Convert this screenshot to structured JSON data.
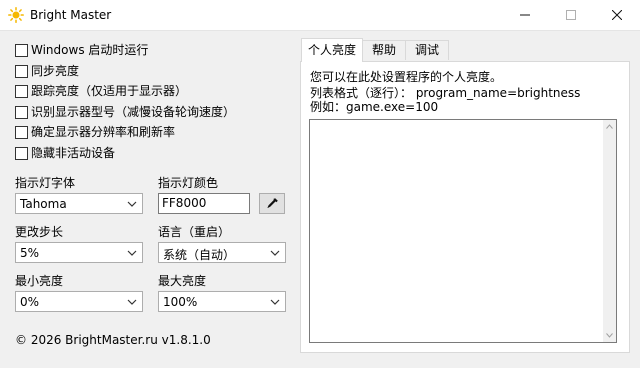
{
  "window": {
    "title": "Bright Master",
    "icon": "sun-icon",
    "minimize": "minimize-icon",
    "maximize": "maximize-icon",
    "close": "close-icon"
  },
  "checkboxes": [
    {
      "label": "Windows 启动时运行",
      "checked": false
    },
    {
      "label": "同步亮度",
      "checked": false
    },
    {
      "label": "跟踪亮度（仅适用于显示器）",
      "checked": false
    },
    {
      "label": "识别显示器型号（减慢设备轮询速度）",
      "checked": false
    },
    {
      "label": "确定显示器分辨率和刷新率",
      "checked": false
    },
    {
      "label": "隐藏非活动设备",
      "checked": false
    }
  ],
  "indicator_font": {
    "label": "指示灯字体",
    "value": "Tahoma"
  },
  "indicator_color": {
    "label": "指示灯颜色",
    "value": "FF8000",
    "picker_icon": "eyedropper-icon"
  },
  "step": {
    "label": "更改步长",
    "value": "5%"
  },
  "language": {
    "label": "语言（重启）",
    "value": "系统（自动）"
  },
  "min_brightness": {
    "label": "最小亮度",
    "value": "0%"
  },
  "max_brightness": {
    "label": "最大亮度",
    "value": "100%"
  },
  "copyright": "© 2026 BrightMaster.ru v1.8.1.0",
  "tabs": [
    {
      "label": "个人亮度",
      "active": true
    },
    {
      "label": "帮助",
      "active": false
    },
    {
      "label": "调试",
      "active": false
    }
  ],
  "panel": {
    "line1": "您可以在此处设置程序的个人亮度。",
    "line2": "列表格式（逐行）： program_name=brightness",
    "line3": "例如：game.exe=100",
    "textarea_value": ""
  },
  "colors": {
    "window_bg": "#f0f0f0",
    "icon_sun": "#f5b800"
  }
}
